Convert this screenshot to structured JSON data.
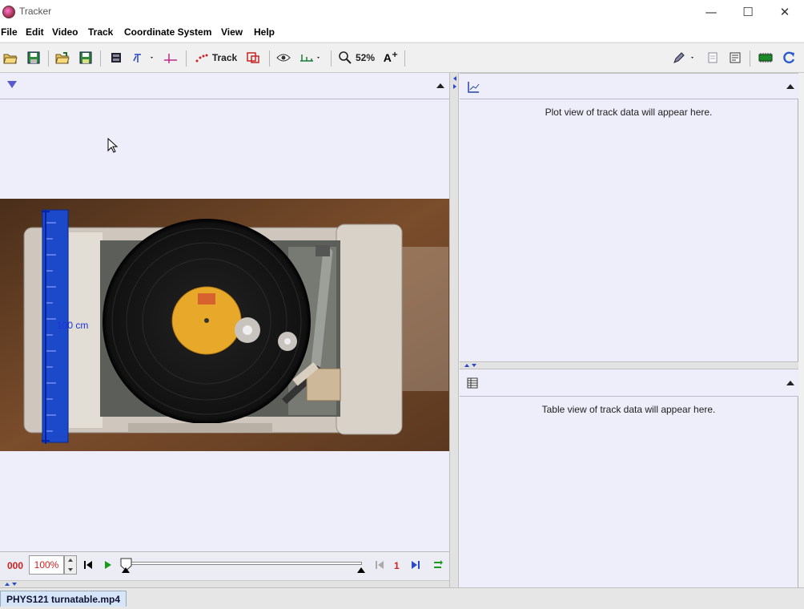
{
  "window": {
    "title": "Tracker"
  },
  "menu": [
    "File",
    "Edit",
    "Video",
    "Track",
    "Coordinate System",
    "View",
    "Help"
  ],
  "toolbar": {
    "track_label": "Track",
    "zoom_label": "52%"
  },
  "plot": {
    "placeholder": "Plot view of track data will appear here."
  },
  "table": {
    "placeholder": "Table view of track data will appear here."
  },
  "video": {
    "calibration_label": "100 cm"
  },
  "player": {
    "frame_number": "000",
    "rate_value": "100%",
    "step_size": "1"
  },
  "file_tab": {
    "label": "PHYS121 turnatable.mp4"
  },
  "colors": {
    "panel_bg": "#eeeefb",
    "frame_red": "#cc2222",
    "ruler_blue": "#1c49c9",
    "play_green": "#1a9a1a"
  }
}
